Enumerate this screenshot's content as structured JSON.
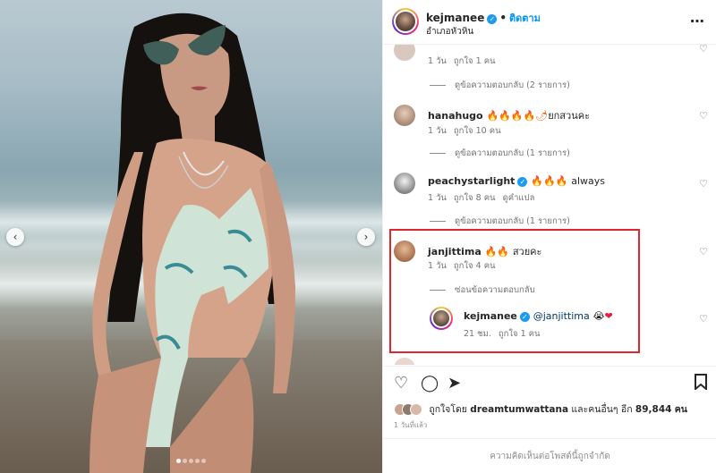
{
  "post": {
    "username": "kejmanee",
    "follow_separator": "•",
    "follow_label": "ติดตาม",
    "location": "อำเภอหัวหิน",
    "more_icon": "more-horizontal-icon"
  },
  "carousel": {
    "prev_arrow": "‹",
    "next_arrow": "›",
    "slide_count": 5,
    "active_slide": 1
  },
  "comments": [
    {
      "username": "",
      "text": "",
      "time": "1 วัน",
      "likes": "ถูกใจ 1 คน",
      "replies": "ดูข้อความตอบกลับ (2 รายการ)"
    },
    {
      "username": "hanahugo",
      "emoji": "🔥🔥🔥🔥🌶",
      "text": "ยกสวนคะ",
      "time": "1 วัน",
      "likes": "ถูกใจ 10 คน",
      "replies": "ดูข้อความตอบกลับ (1 รายการ)"
    },
    {
      "username": "peachystarlight",
      "emoji": "🔥🔥🔥",
      "text": "always",
      "time": "1 วัน",
      "likes": "ถูกใจ 8 คน",
      "translate": "ดูคำแปล",
      "replies": "ดูข้อความตอบกลับ (1 รายการ)"
    },
    {
      "username": "janjittima",
      "emoji": "🔥🔥",
      "text": "สวยคะ",
      "time": "1 วัน",
      "likes": "ถูกใจ 4 คน",
      "replies": "ซ่อนข้อความตอบกลับ"
    }
  ],
  "reply": {
    "username": "kejmanee",
    "mention": "@janjittima",
    "emoji": "😭",
    "heart": "❤",
    "time": "21 ชม.",
    "likes": "ถูกใจ 1 คน"
  },
  "actions": {
    "like_icon": "heart-icon",
    "comment_icon": "comment-icon",
    "share_icon": "send-icon",
    "save_icon": "bookmark-icon"
  },
  "likes": {
    "prefix": "ถูกใจโดย",
    "user": "dreamtumwattana",
    "middle": "และคนอื่นๆ อีก",
    "count": "89,844",
    "suffix": "คน"
  },
  "time_ago": "1 วันที่แล้ว",
  "footer": "ความคิดเห็นต่อโพสต์นี้ถูกจำกัด",
  "colors": {
    "link_blue": "#0095f6",
    "highlight_red": "#e0262f",
    "verified_blue": "#1d9bf0"
  }
}
